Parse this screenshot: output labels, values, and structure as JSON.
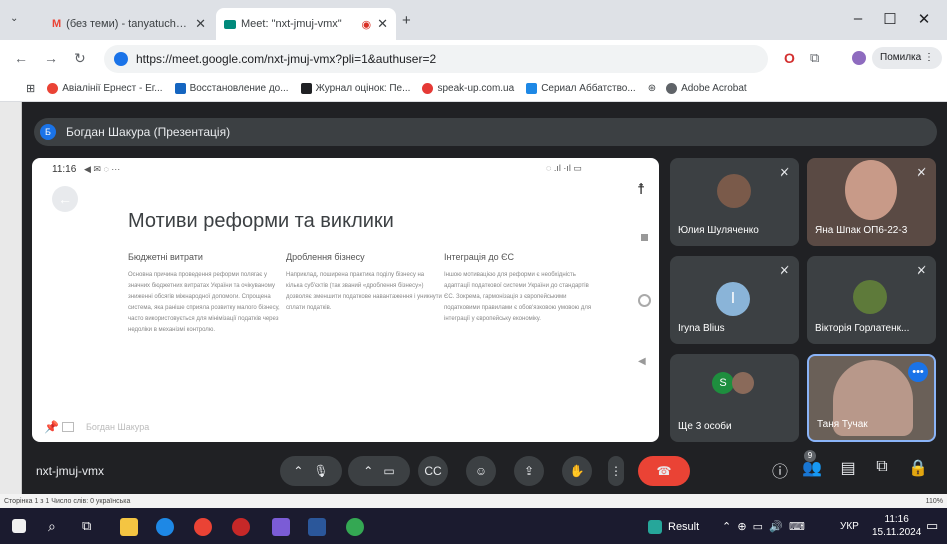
{
  "browser": {
    "tabs": [
      {
        "title": "(без теми) - tanyatuchak75@g",
        "icon": "gmail-icon",
        "color": "#ea4335"
      },
      {
        "title": "Meet: \"nxt-jmuj-vmx\"",
        "icon": "meet-icon",
        "color": "#00897b"
      }
    ],
    "url": "https://meet.google.com/nxt-jmuj-vmx?pli=1&authuser=2",
    "error_label": "Помилка",
    "bookmarks": [
      {
        "label": "Авіалінії Ернест - Ег...",
        "color": "#ea4335"
      },
      {
        "label": "Восстановление до...",
        "color": "#1565c0"
      },
      {
        "label": "Журнал оцінок: Пе...",
        "color": "#202124"
      },
      {
        "label": "speak-up.com.ua",
        "color": "#e53935"
      },
      {
        "label": "Сериал Аббатство...",
        "color": "#1e88e5"
      },
      {
        "label": "Adobe Acrobat",
        "color": "#5f6368"
      }
    ]
  },
  "meet": {
    "presenter_initial": "Б",
    "presenter_label": "Богдан Шакура (Презентація)",
    "slide": {
      "status_time": "11:16",
      "title": "Мотиви реформи та виклики",
      "columns": [
        {
          "heading": "Бюджетні витрати",
          "text": "Основна причина проведення реформи полягає у значних бюджетних витратах України та очікуваному зниженні обсягів міжнародної допомоги. Спрощена система, яка раніше сприяла розвитку малого бізнесу, часто використовується для мінімізації податків через недоліки в механізмі контролю."
        },
        {
          "heading": "Дроблення бізнесу",
          "text": "Наприклад, поширена практика поділу бізнесу на кілька суб'єктів (так званий «дроблення бізнесу») дозволяє зменшити податкове навантаження і уникнути сплати податків."
        },
        {
          "heading": "Інтеграція до ЄС",
          "text": "Іншою мотивацією для реформи є необхідність адаптації податкової системи України до стандартів ЄС. Зокрема, гармонізація з європейськими податковими правилами є обов'язковою умовою для інтеграції у європейську економіку."
        }
      ],
      "presenter_footer": "Богдан Шакура"
    },
    "participants": [
      {
        "name": "Юлия Шуляченко"
      },
      {
        "name": "Яна Шпак ОП6-22-3"
      },
      {
        "name": "Iryna Blius",
        "initial": "I"
      },
      {
        "name": "Вікторія Горлатенк..."
      },
      {
        "name": "Ще 3 особи",
        "initial": "S"
      },
      {
        "name": "Таня Тучак"
      }
    ],
    "meeting_code": "nxt-jmuj-vmx",
    "people_count": "9"
  },
  "word": {
    "status": "Сторінка 1 з 1   Число слів: 0   українська",
    "zoom": "110%"
  },
  "taskbar": {
    "result_label": "Result",
    "lang": "УКР",
    "time": "11:16",
    "date": "15.11.2024"
  }
}
